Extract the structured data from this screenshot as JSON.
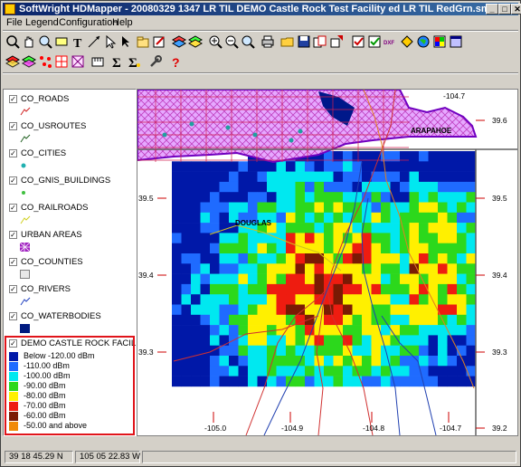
{
  "window": {
    "title": "SoftWright HDMapper - 20080329 1347 LR TIL DEMO Castle Rock Test Facility ed LR TIL RedGrn.smf",
    "minimize": "_",
    "maximize": "□",
    "close": "✕"
  },
  "menu": [
    "File",
    "Legend",
    "Configuration",
    "Help"
  ],
  "toolbar_row1": [
    "zoom-pointer",
    "hand-pan",
    "magnify",
    "label",
    "text",
    "line",
    "select",
    "pan-arrow",
    "open-layer",
    "edit",
    "layers",
    "layers-2",
    "zoom-in",
    "zoom-out",
    "zoom-extent",
    "print",
    "open",
    "save",
    "copy",
    "export",
    "check",
    "clear",
    "dxf",
    "fill",
    "globe",
    "palette",
    "window"
  ],
  "toolbar_row2": [
    "layer-red",
    "layer-multi",
    "points-red",
    "grid-red",
    "measure",
    "sigma",
    "sigma-2",
    "wrench",
    "help"
  ],
  "layers": [
    {
      "name": "CO_ROADS",
      "checked": true,
      "symbol": "road"
    },
    {
      "name": "CO_USROUTES",
      "checked": true,
      "symbol": "usroute"
    },
    {
      "name": "CO_CITIES",
      "checked": true,
      "symbol": "city"
    },
    {
      "name": "CO_GNIS_BUILDINGS",
      "checked": true,
      "symbol": "building"
    },
    {
      "name": "CO_RAILROADS",
      "checked": true,
      "symbol": "railroad"
    },
    {
      "name": "URBAN AREAS",
      "checked": true,
      "symbol": "urban"
    },
    {
      "name": "CO_COUNTIES",
      "checked": true,
      "symbol": "county"
    },
    {
      "name": "CO_RIVERS",
      "checked": true,
      "symbol": "river"
    },
    {
      "name": "CO_WATERBODIES",
      "checked": true,
      "symbol": "water"
    },
    {
      "name": "DEMO CASTLE ROCK FACILITY",
      "checked": true,
      "symbol": "none"
    }
  ],
  "signal_legend": [
    {
      "label": "Below -120.00 dBm",
      "color": "#0018a8"
    },
    {
      "label": "-110.00 dBm",
      "color": "#1f6bff"
    },
    {
      "label": "-100.00 dBm",
      "color": "#00e8f0"
    },
    {
      "label": "-90.00 dBm",
      "color": "#2cd81c"
    },
    {
      "label": "-80.00 dBm",
      "color": "#fff000"
    },
    {
      "label": "-70.00 dBm",
      "color": "#ee1c10"
    },
    {
      "label": "-60.00 dBm",
      "color": "#7a1a04"
    },
    {
      "label": "-50.00 and above",
      "color": "#f08a08"
    }
  ],
  "map": {
    "lon_labels_top": [
      "-104.7"
    ],
    "lon_labels_bottom": [
      "-105.0",
      "-104.9",
      "-104.8",
      "-104.7"
    ],
    "lat_labels_right": [
      "39.6",
      "39.5",
      "39.4",
      "39.3",
      "39.2"
    ],
    "lat_labels_left": [
      "39.5",
      "39.4",
      "39.3"
    ],
    "county_label": "ARAPAHOE",
    "city_label": "DOUGLAS"
  },
  "status": {
    "latitude": "39 18 45.29 N",
    "longitude": "105 05 22.83 W"
  }
}
